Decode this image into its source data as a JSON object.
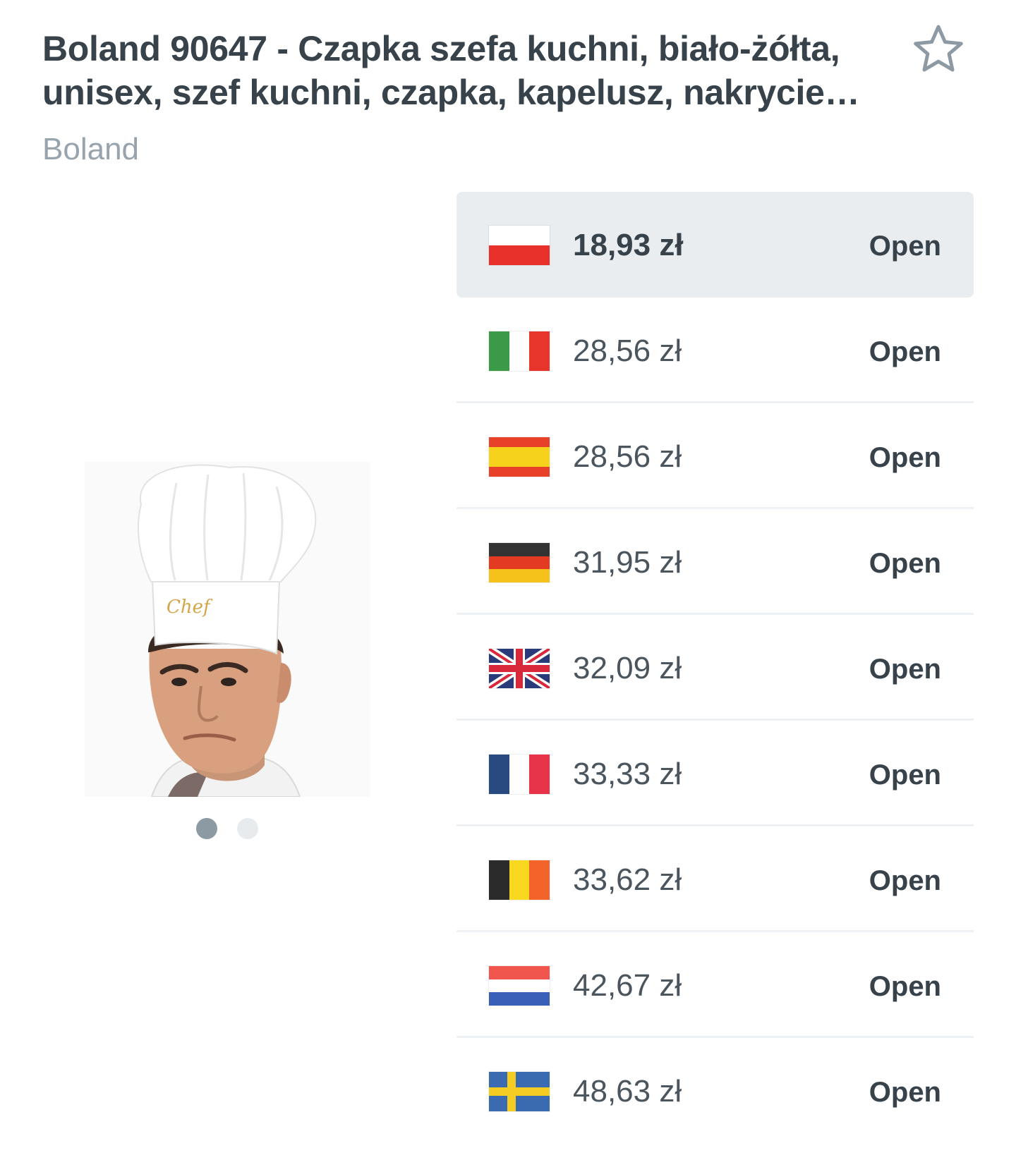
{
  "product": {
    "title": "Boland 90647 - Czapka szefa kuchni, biało-żółta,\nunisex, szef kuchni, czapka, kapelusz, nakrycie…",
    "brand": "Boland",
    "favorite_icon": "star-outline-icon",
    "image_text": "Chef",
    "gallery": {
      "count": 2,
      "active": 1
    }
  },
  "offers": [
    {
      "country": "PL",
      "price": "18,93 zł",
      "action": "Open",
      "best": true
    },
    {
      "country": "IT",
      "price": "28,56 zł",
      "action": "Open"
    },
    {
      "country": "ES",
      "price": "28,56 zł",
      "action": "Open"
    },
    {
      "country": "DE",
      "price": "31,95 zł",
      "action": "Open"
    },
    {
      "country": "GB",
      "price": "32,09 zł",
      "action": "Open"
    },
    {
      "country": "FR",
      "price": "33,33 zł",
      "action": "Open"
    },
    {
      "country": "BE",
      "price": "33,62 zł",
      "action": "Open"
    },
    {
      "country": "NL",
      "price": "42,67 zł",
      "action": "Open"
    },
    {
      "country": "SE",
      "price": "48,63 zł",
      "action": "Open"
    }
  ],
  "colors": {
    "title": "#37424a",
    "brand": "#98a4ad",
    "highlight": "#e9edf0"
  }
}
